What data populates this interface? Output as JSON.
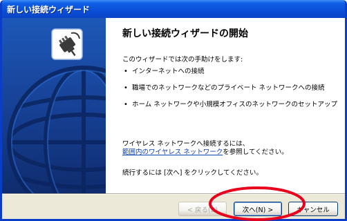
{
  "window": {
    "title": "新しい接続ウィザード"
  },
  "content": {
    "heading": "新しい接続ウィザードの開始",
    "intro": "このウィザードでは次の手助けをします:",
    "bullets": [
      "インターネットへの接続",
      "職場でのネットワークなどのプライベート ネットワークへの接続",
      "ホーム ネットワークや小規模オフィスのネットワークのセットアップ"
    ],
    "wireless_line1": "ワイヤレス ネットワークへ接続するには、",
    "wireless_link": "範囲内のワイヤレス ネットワーク",
    "wireless_suffix": "を参照してください。",
    "continue_text": "続行するには [次へ] をクリックしてください。"
  },
  "buttons": {
    "back_label": "< 戻る(B)",
    "next_label": "次へ(N) >",
    "cancel_label": "キャンセル",
    "back_enabled": false
  },
  "colors": {
    "title_bar": "#0a4fd8",
    "left_panel": "#163f92",
    "highlight": "#e8001c",
    "link": "#0b3fb4"
  },
  "icons": {
    "wizard_icon": "network-connection-plug-icon",
    "left_panel_graphic": "globe-graphic"
  }
}
